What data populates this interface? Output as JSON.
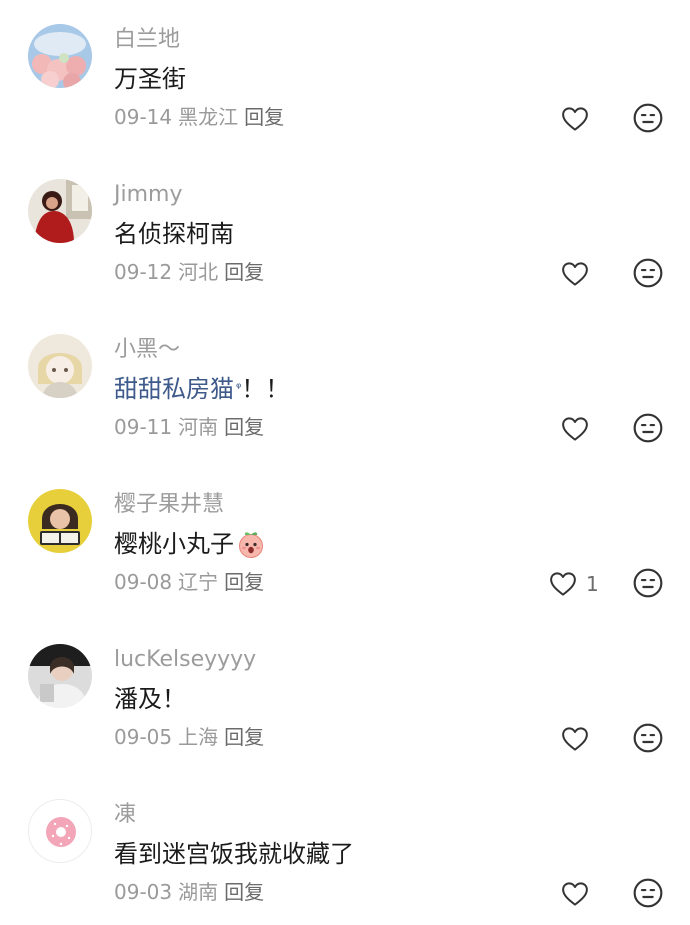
{
  "comments": [
    {
      "user": "白兰地",
      "text": "万圣街",
      "date": "09-14",
      "location": "黑龙江",
      "reply_label": "回复",
      "likes": ""
    },
    {
      "user": "Jimmy",
      "text": "名侦探柯南",
      "date": "09-12",
      "location": "河北",
      "reply_label": "回复",
      "likes": ""
    },
    {
      "user": "小黑～",
      "mention": "甜甜私房猫",
      "mention_mark": "ᵠ",
      "text_suffix": "！！",
      "date": "09-11",
      "location": "河南",
      "reply_label": "回复",
      "likes": ""
    },
    {
      "user": "樱子果井慧",
      "text": "樱桃小丸子",
      "date": "09-08",
      "location": "辽宁",
      "reply_label": "回复",
      "likes": "1"
    },
    {
      "user": "lucKelseyyyy",
      "text": "潘及！",
      "date": "09-05",
      "location": "上海",
      "reply_label": "回复",
      "likes": ""
    },
    {
      "user": "凍",
      "text": "看到迷宫饭我就收藏了",
      "date": "09-03",
      "location": "湖南",
      "reply_label": "回复",
      "likes": ""
    }
  ],
  "icons": {
    "like": "heart-outline-icon",
    "dislike": "meh-face-icon",
    "emoji": "surprised-peach-emoji"
  },
  "colors": {
    "mention": "#3d5a8a",
    "muted": "#9a9a9a"
  }
}
